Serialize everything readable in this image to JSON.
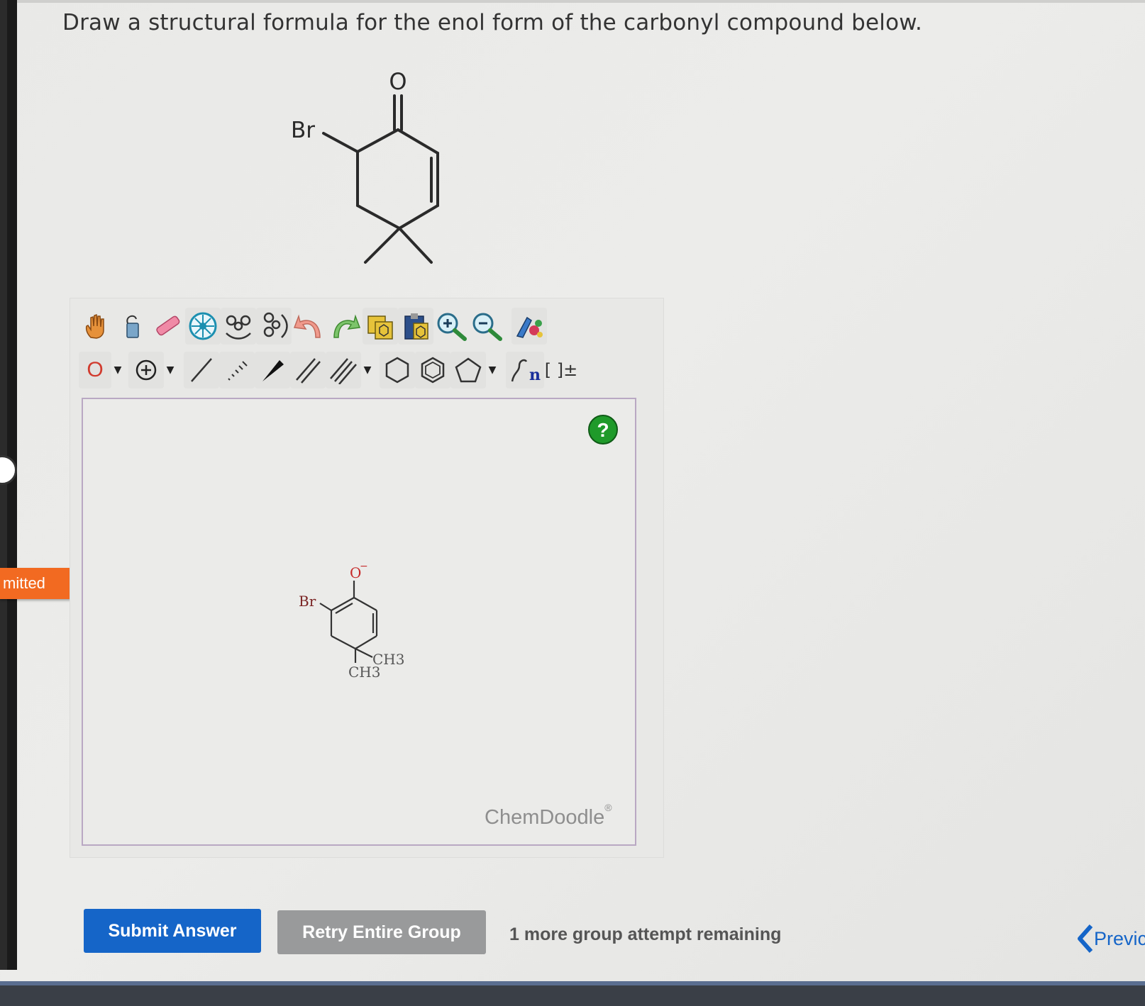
{
  "question": {
    "text": "Draw a structural formula for the enol form of the carbonyl compound below."
  },
  "molecule": {
    "oxygen_label": "O",
    "bromine_label": "Br"
  },
  "status_tag": {
    "label": "mitted"
  },
  "toolbar": {
    "atom_label": "O",
    "polymer_label": "n",
    "bracket_label": "[ ]±"
  },
  "canvas": {
    "help_label": "?",
    "brand": "ChemDoodle",
    "brand_mark": "®",
    "drawn": {
      "oxygen": "O",
      "charge": "−",
      "bromine": "Br",
      "methyl_1": "CH3",
      "methyl_2": "CH3"
    }
  },
  "actions": {
    "submit_label": "Submit Answer",
    "retry_label": "Retry Entire Group",
    "attempts_text": "1 more group attempt remaining",
    "prev_label": "Previc"
  },
  "colors": {
    "submit": "#1565c8",
    "retry": "#999a9b",
    "status": "#f26a21",
    "help": "#1f9a2a"
  }
}
